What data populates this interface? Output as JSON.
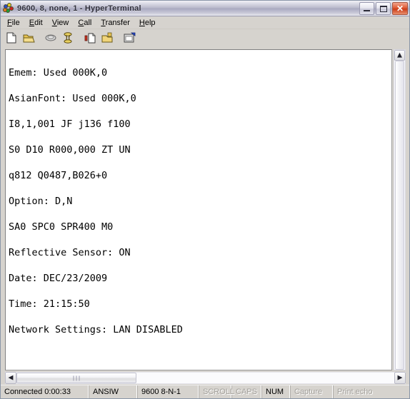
{
  "window": {
    "title": "9600, 8, none, 1 - HyperTerminal",
    "icon": "hyperterminal-icon",
    "controls": {
      "minimize": "Minimize",
      "maximize": "Maximize",
      "close": "Close"
    }
  },
  "menubar": {
    "items": [
      {
        "label": "File",
        "mnemonic": "F"
      },
      {
        "label": "Edit",
        "mnemonic": "E"
      },
      {
        "label": "View",
        "mnemonic": "V"
      },
      {
        "label": "Call",
        "mnemonic": "C"
      },
      {
        "label": "Transfer",
        "mnemonic": "T"
      },
      {
        "label": "Help",
        "mnemonic": "H"
      }
    ]
  },
  "toolbar": {
    "buttons": [
      {
        "name": "new-connection-icon",
        "tooltip": "New"
      },
      {
        "name": "open-folder-icon",
        "tooltip": "Open"
      },
      {
        "name": "call-icon",
        "tooltip": "Call"
      },
      {
        "name": "disconnect-icon",
        "tooltip": "Disconnect"
      },
      {
        "name": "send-file-icon",
        "tooltip": "Send"
      },
      {
        "name": "receive-file-icon",
        "tooltip": "Receive"
      },
      {
        "name": "properties-icon",
        "tooltip": "Properties"
      }
    ]
  },
  "terminal": {
    "lines": [
      "Emem: Used 000K,0",
      "AsianFont: Used 000K,0",
      "I8,1,001 JF j136 f100",
      "S0 D10 R000,000 ZT UN",
      "q812 Q0487,B026+0",
      "Option: D,N",
      "SA0 SPC0 SPR400 M0",
      "Reflective Sensor: ON",
      "Date: DEC/23/2009",
      "Time: 21:15:50",
      "Network Settings: LAN DISABLED"
    ]
  },
  "scrollbars": {
    "vertical": {
      "up_arrow": "▲",
      "down_arrow": "▼"
    },
    "horizontal": {
      "left_arrow": "◀",
      "right_arrow": "▶"
    }
  },
  "statusbar": {
    "connection": "Connected 0:00:33",
    "emulation": "ANSIW",
    "settings": "9600 8-N-1",
    "scroll": "SCROLL",
    "caps": "CAPS",
    "num": "NUM",
    "capture": "Capture",
    "print_echo": "Print echo"
  },
  "colors": {
    "frame": "#d6d3ce",
    "terminal_bg": "#ffffff",
    "terminal_fg": "#000000",
    "close_button": "#cc3d19",
    "status_dim": "#a3a09b"
  }
}
